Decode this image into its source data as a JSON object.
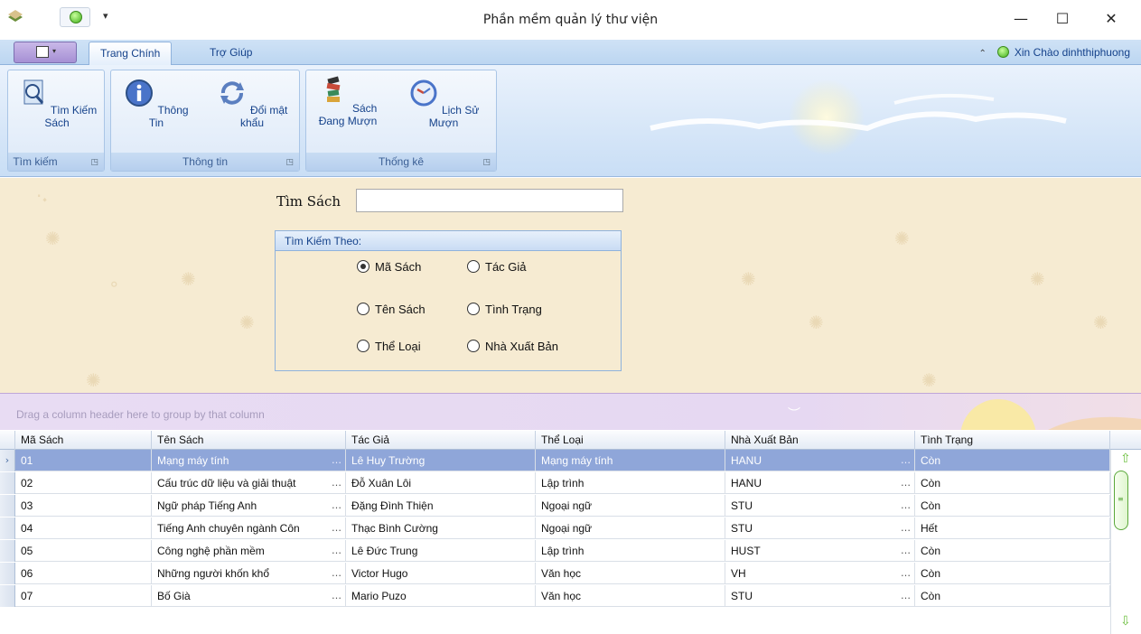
{
  "window": {
    "title": "Phần mềm quản lý thư viện",
    "minimize": "—",
    "maximize": "☐",
    "close": "✕"
  },
  "ribbon": {
    "tabs": [
      {
        "label": "Trang Chính",
        "active": true
      },
      {
        "label": "Trợ Giúp",
        "active": false
      }
    ],
    "greeting": "Xin Chào dinhthiphuong",
    "groups": [
      {
        "label": "Tìm kiếm",
        "buttons": [
          {
            "label": "Tìm Kiếm Sách",
            "icon": "search-book-icon"
          }
        ]
      },
      {
        "label": "Thông tin",
        "buttons": [
          {
            "label": "Thông Tin",
            "icon": "info-icon"
          },
          {
            "label": "Đổi mật khẩu",
            "icon": "refresh-password-icon"
          }
        ]
      },
      {
        "label": "Thống kê",
        "buttons": [
          {
            "label": "Sách Đang Mượn",
            "icon": "book-stack-icon"
          },
          {
            "label": "Lịch Sử Mượn",
            "icon": "history-clock-icon"
          }
        ]
      }
    ]
  },
  "search": {
    "label": "Tìm Sách",
    "value": "",
    "criteria_title": "Tìm Kiếm Theo:",
    "options": [
      {
        "label": "Mã Sách",
        "checked": true
      },
      {
        "label": "Tác Giả",
        "checked": false
      },
      {
        "label": "Tên Sách",
        "checked": false
      },
      {
        "label": "Tình Trạng",
        "checked": false
      },
      {
        "label": "Thể Loại",
        "checked": false
      },
      {
        "label": "Nhà Xuất Bản",
        "checked": false
      }
    ]
  },
  "grid": {
    "group_hint": "Drag a column header here to group by that column",
    "columns": [
      "Mã Sách",
      "Tên Sách",
      "Tác Giả",
      "Thể Loại",
      "Nhà Xuất Bản",
      "Tình Trạng"
    ],
    "selected_row": 0,
    "rows": [
      [
        "01",
        "Mạng máy tính",
        "Lê Huy Trường",
        "Mạng máy tính",
        "HANU",
        "Còn"
      ],
      [
        "02",
        "Cấu trúc dữ liệu và giải thuật",
        "Đỗ Xuân Lôi",
        "Lập trình",
        "HANU",
        "Còn"
      ],
      [
        "03",
        "Ngữ pháp Tiếng Anh",
        "Đặng Đình Thiện",
        "Ngoại ngữ",
        "STU",
        "Còn"
      ],
      [
        "04",
        "Tiếng Anh chuyên ngành Côn",
        "Thạc Bình Cường",
        "Ngoại ngữ",
        "STU",
        "Hết"
      ],
      [
        "05",
        "Công nghệ phần mềm",
        "Lê Đức Trung",
        "Lập trình",
        "HUST",
        "Còn"
      ],
      [
        "06",
        "Những người khốn khổ",
        "Victor Hugo",
        "Văn học",
        "VH",
        "Còn"
      ],
      [
        "07",
        "Bố Già",
        "Mario Puzo",
        "Văn học",
        "STU",
        "Còn"
      ]
    ]
  },
  "colors": {
    "ribbon": "#d6e6f8",
    "panel": "#f6ebd2",
    "selection": "#8fa6d9",
    "groupbar": "#e8dcf3"
  }
}
